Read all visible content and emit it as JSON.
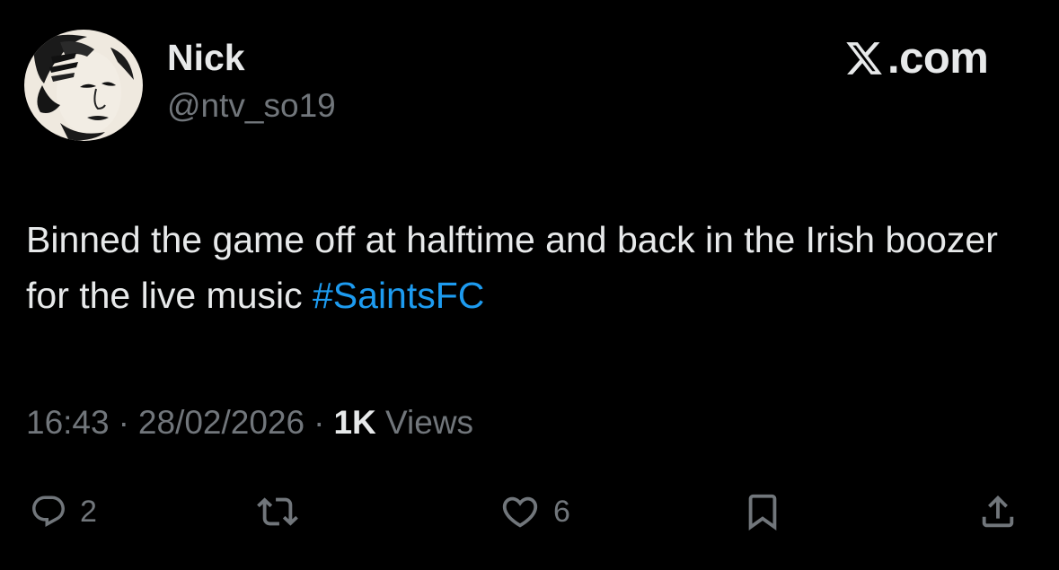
{
  "author": {
    "display_name": "Nick",
    "handle": "@ntv_so19"
  },
  "watermark": {
    "text": ".com",
    "icon": "x-logo-icon"
  },
  "tweet": {
    "text": "Binned the game off at halftime and back in the Irish boozer for the live music ",
    "hashtag": "#SaintsFC"
  },
  "meta": {
    "time": "16:43",
    "separator": "·",
    "date": "28/02/2026",
    "views_count": "1K",
    "views_label": "Views"
  },
  "actions": {
    "reply": {
      "icon": "reply-icon",
      "count": "2"
    },
    "retweet": {
      "icon": "retweet-icon",
      "count": ""
    },
    "like": {
      "icon": "heart-icon",
      "count": "6"
    },
    "bookmark": {
      "icon": "bookmark-icon"
    },
    "share": {
      "icon": "share-icon"
    }
  },
  "colors": {
    "background": "#000000",
    "text": "#e7e9ea",
    "secondary": "#71767b",
    "accent": "#1d9bf0"
  }
}
